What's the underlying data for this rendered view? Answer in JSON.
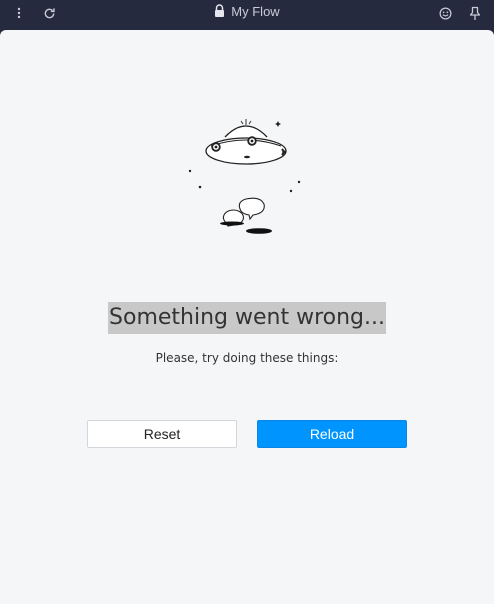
{
  "window": {
    "title": "My Flow"
  },
  "icons": {
    "menu": "more-vertical-icon",
    "reload": "refresh-icon",
    "lock": "lock-icon",
    "emoji": "smiley-icon",
    "pin": "pin-icon"
  },
  "error": {
    "heading": "Something went wrong...",
    "subtext": "Please, try doing these things:"
  },
  "buttons": {
    "reset_label": "Reset",
    "reload_label": "Reload"
  },
  "colors": {
    "titlebar": "#262a3f",
    "background": "#f5f6f8",
    "primary": "#0094ff",
    "heading_highlight": "#c8c8c8"
  }
}
